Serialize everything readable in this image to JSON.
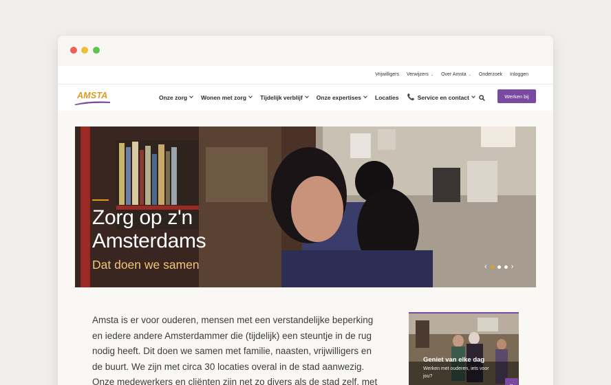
{
  "colors": {
    "brand_orange": "#e19a1f",
    "brand_purple": "#7a4aa0"
  },
  "topbar": {
    "links": [
      "Vrijwilligers",
      "Verwijzers",
      "Over Amsta",
      "Onderzoek",
      "Inloggen"
    ]
  },
  "header": {
    "logo_text": "AMSTA",
    "nav": [
      "Onze zorg",
      "Wonen met zorg",
      "Tijdelijk verblijf",
      "Onze expertises",
      "Locaties",
      "Service en contact"
    ],
    "cta_label": "Werken bij"
  },
  "hero": {
    "title": "Zorg op z'n Amsterdams",
    "subtitle": "Dat doen we samen",
    "slides_count": 3,
    "active_slide": 1
  },
  "intro": {
    "text": "Amsta is er voor ouderen, mensen met een verstandelijke beperking en iedere andere Amsterdammer die (tijdelijk) een steuntje in de rug nodig heeft. Dit doen we samen met familie, naasten, vrijwilligers en de buurt. We zijn met circa 30 locaties overal in de stad aanwezig. Onze medewerkers en cliënten zijn net zo divers als de stad zelf, met"
  },
  "card": {
    "title": "Geniet van elke dag",
    "text": "Werken met ouderen, iets voor jou?"
  }
}
